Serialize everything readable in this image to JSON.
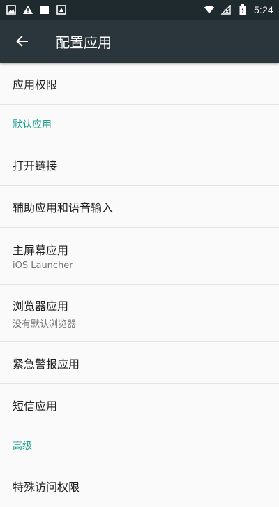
{
  "status_bar": {
    "time": "5:24",
    "left_icons": [
      "image-notification-icon",
      "warning-icon",
      "blank-notification-icon",
      "sim-notification-icon"
    ],
    "right_icons": [
      "wifi-icon",
      "no-signal-icon",
      "battery-charging-icon"
    ]
  },
  "app_bar": {
    "title": "配置应用"
  },
  "sections": [
    {
      "type": "item",
      "label": "应用权限"
    },
    {
      "type": "header",
      "label": "默认应用"
    },
    {
      "type": "item",
      "label": "打开链接"
    },
    {
      "type": "item",
      "label": "辅助应用和语音输入"
    },
    {
      "type": "item",
      "label": "主屏幕应用",
      "sub": "iOS Launcher"
    },
    {
      "type": "item",
      "label": "浏览器应用",
      "sub": "没有默认浏览器"
    },
    {
      "type": "item",
      "label": "紧急警报应用"
    },
    {
      "type": "item",
      "label": "短信应用"
    },
    {
      "type": "header",
      "label": "高级"
    },
    {
      "type": "item",
      "label": "特殊访问权限"
    }
  ]
}
